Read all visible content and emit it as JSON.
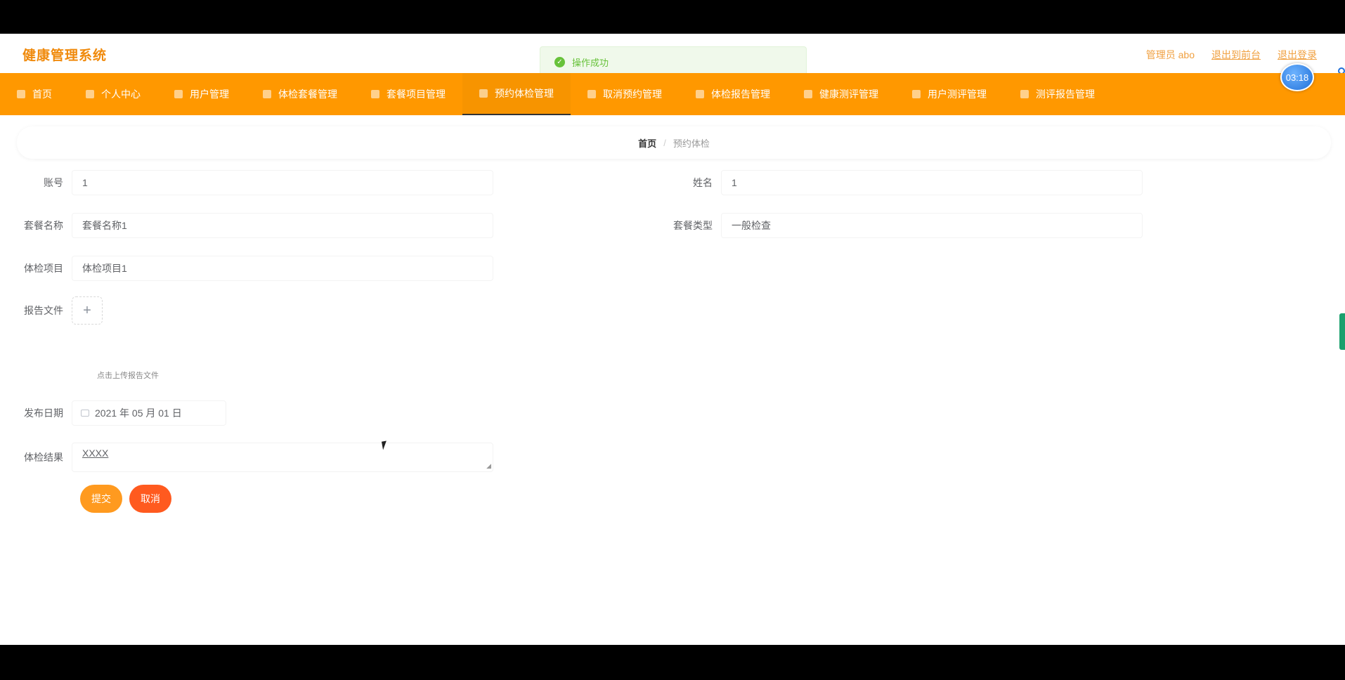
{
  "header": {
    "brand": "健康管理系统",
    "user_label": "管理员 abo",
    "exit_frontend": "退出到前台",
    "logout": "退出登录"
  },
  "toast": {
    "message": "操作成功"
  },
  "timer": {
    "value": "03:18"
  },
  "nav": {
    "items": [
      {
        "label": "首页"
      },
      {
        "label": "个人中心"
      },
      {
        "label": "用户管理"
      },
      {
        "label": "体检套餐管理"
      },
      {
        "label": "套餐项目管理"
      },
      {
        "label": "预约体检管理"
      },
      {
        "label": "取消预约管理"
      },
      {
        "label": "体检报告管理"
      },
      {
        "label": "健康测评管理"
      },
      {
        "label": "用户测评管理"
      },
      {
        "label": "测评报告管理"
      }
    ],
    "active_index": 5
  },
  "breadcrumb": {
    "home": "首页",
    "separator": "/",
    "current": "预约体检"
  },
  "form": {
    "account_label": "账号",
    "account_value": "1",
    "name_label": "姓名",
    "name_value": "1",
    "package_name_label": "套餐名称",
    "package_name_value": "套餐名称1",
    "package_type_label": "套餐类型",
    "package_type_value": "一般检查",
    "item_label": "体检项目",
    "item_value": "体检项目1",
    "report_label": "报告文件",
    "upload_plus": "+",
    "upload_tip": "点击上传报告文件",
    "date_label": "发布日期",
    "date_value": "2021 年 05 月 01 日",
    "result_label": "体检结果",
    "result_value": "XXXX",
    "submit": "提交",
    "cancel": "取消"
  },
  "colors": {
    "nav_bg": "#ff9800",
    "brand": "#f08a0c",
    "submit": "#ff9a1f",
    "cancel": "#ff5a1f",
    "toast_success": "#67c23a"
  }
}
